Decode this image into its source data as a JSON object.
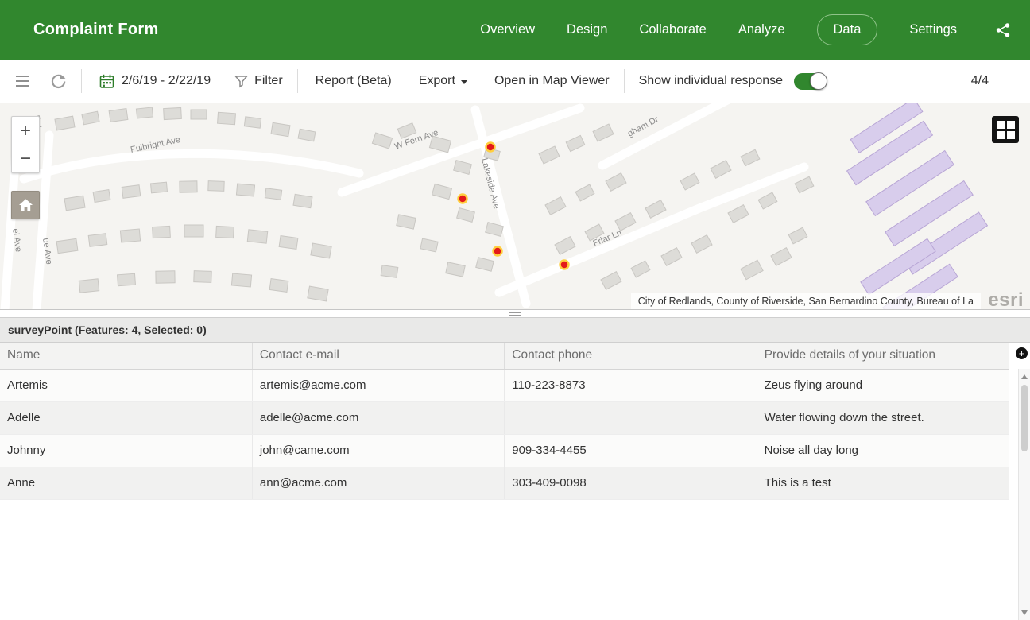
{
  "header": {
    "title": "Complaint Form",
    "nav": [
      {
        "label": "Overview"
      },
      {
        "label": "Design"
      },
      {
        "label": "Collaborate"
      },
      {
        "label": "Analyze"
      },
      {
        "label": "Data",
        "active": true
      },
      {
        "label": "Settings"
      }
    ]
  },
  "toolbar": {
    "date_range": "2/6/19 - 2/22/19",
    "filter": "Filter",
    "report": "Report (Beta)",
    "export": "Export",
    "open_in_map_viewer": "Open in Map Viewer",
    "show_individual_response": "Show individual response",
    "toggle_state": "on",
    "count": "4/4"
  },
  "map": {
    "street_labels": {
      "fulbright": "Fulbright Ave",
      "fern": "W Fern Ave",
      "lakeside": "Lakeside Ave",
      "friar": "Friar Ln",
      "gham": "gham Dr",
      "el": "el Ave",
      "ue": "ue Ave",
      "bel": "Bel"
    },
    "attribution": "City of Redlands, County of Riverside, San Bernardino County, Bureau of La",
    "esri_logo": "esri",
    "zoom_in": "+",
    "zoom_out": "−",
    "point_count": 4
  },
  "table": {
    "title": "surveyPoint (Features: 4, Selected: 0)",
    "columns": [
      "Name",
      "Contact e-mail",
      "Contact phone",
      "Provide details of your situation"
    ],
    "rows": [
      [
        "Artemis",
        "artemis@acme.com",
        "110-223-8873",
        "Zeus flying around"
      ],
      [
        "Adelle",
        "adelle@acme.com",
        "",
        "Water flowing down the street."
      ],
      [
        "Johnny",
        "john@came.com",
        "909-334-4455",
        "Noise all day long"
      ],
      [
        "Anne",
        "ann@acme.com",
        "303-409-0098",
        "This is a test"
      ]
    ]
  },
  "colors": {
    "brand_green": "#31872E",
    "point_fill": "#E31A1A",
    "point_ring": "#FFCF3F",
    "purple_building": "#D8CDEC"
  }
}
